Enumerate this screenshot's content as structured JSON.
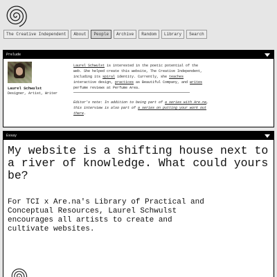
{
  "nav": {
    "items": [
      {
        "label": "The Creative Independent"
      },
      {
        "label": "About"
      },
      {
        "label": "People"
      },
      {
        "label": "Archive"
      },
      {
        "label": "Random"
      },
      {
        "label": "Library"
      },
      {
        "label": "Search"
      }
    ],
    "active": "People"
  },
  "prelude": {
    "header": "Prelude",
    "person_name": "Laurel Schwulst",
    "person_role": "Designer, Artist, Writer",
    "bio": {
      "name_link": "Laurel Schwulst",
      "t1": " is interested in the poetic potential of the web. She helped create this website, The Creative Independent, including its ",
      "spiral_link": "spiral",
      "t2": " identity. Currently, she ",
      "teaches_link": "teaches",
      "t3": " interactive design, ",
      "practices_link": "practices",
      "t4": " as Beautiful Company, and ",
      "writes_link": "writes",
      "t5": " perfume reviews at Perfume Area."
    },
    "note": {
      "t1": "Editor's note: In addition to being part of ",
      "link1": "a series with Are.na",
      "t2": ", this interview is also part of ",
      "link2": "a series on putting your work out there",
      "t3": "."
    }
  },
  "essay": {
    "header": "Essay",
    "headline": "My website is a shifting house next to a river of knowledge. What could yours be?",
    "subhead": "For TCI x Are.na's Library of Practical and Conceptual Resources, Laurel Schwulst encourages all artists to create and cultivate websites."
  },
  "icons": {
    "logo": "spiral-icon",
    "collapse": "caret-down-icon"
  }
}
